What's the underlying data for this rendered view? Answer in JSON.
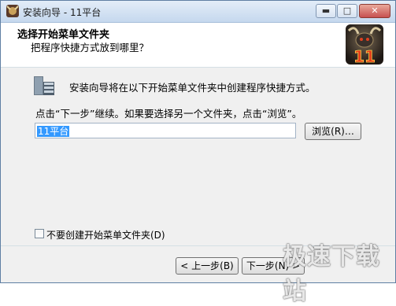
{
  "window": {
    "title": "安装向导 - 11平台",
    "minimize_symbol": "▬",
    "maximize_symbol": "□",
    "close_symbol": "✕"
  },
  "header": {
    "title": "选择开始菜单文件夹",
    "subtitle": "把程序快捷方式放到哪里？",
    "logo_text": "11"
  },
  "content": {
    "description": "安装向导将在以下开始菜单文件夹中创建程序快捷方式。",
    "instruction": "点击“下一步”继续。如果要选择另一个文件夹，点击“浏览”。",
    "folder_value": "11平台",
    "browse_label": "浏览(R)…",
    "no_folder_checkbox_label": "不要创建开始菜单文件夹(D)",
    "no_folder_checked": false
  },
  "footer": {
    "back_label": "< 上一步(B)",
    "next_label": "下一步(N) >"
  },
  "watermark": "极速下载站",
  "colors": {
    "title_bar": "#c5d8ee",
    "selection": "#3399ff",
    "close_button": "#c75050"
  }
}
